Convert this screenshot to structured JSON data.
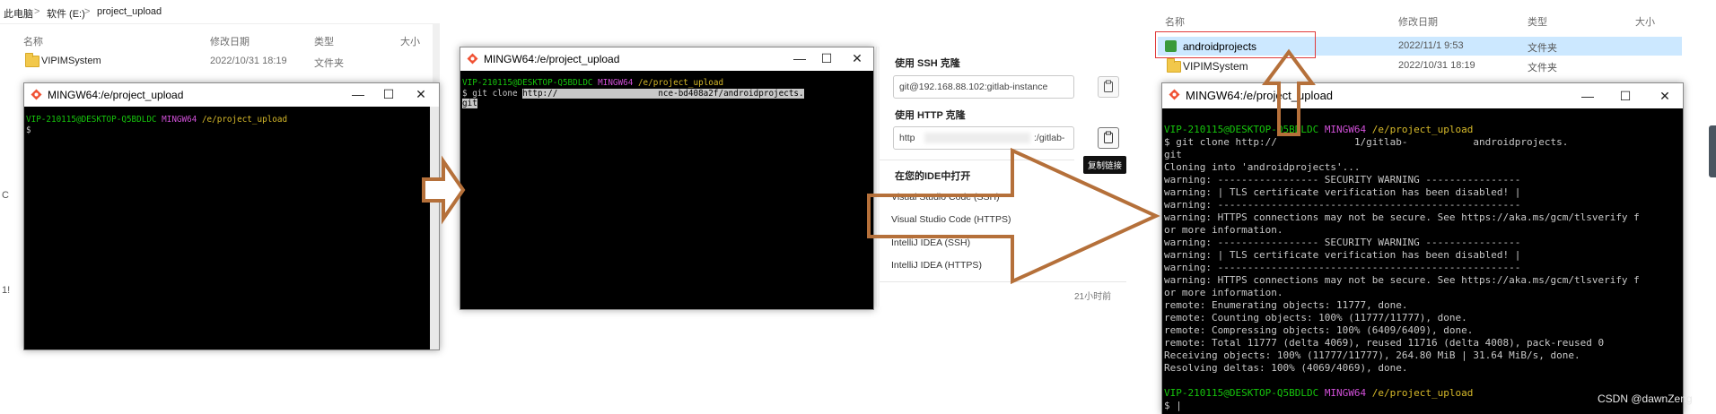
{
  "explorer_left": {
    "breadcrumb": [
      "此电脑",
      ">",
      "软件 (E:)",
      ">",
      "project_upload"
    ],
    "columns": [
      "名称",
      "修改日期",
      "类型",
      "大小"
    ],
    "rows": [
      {
        "name": "VIPIMSystem",
        "date": "2022/10/31 18:19",
        "type": "文件夹"
      }
    ],
    "side_labels": [
      "C",
      "1!"
    ]
  },
  "terminal_small": {
    "title": "MINGW64:/e/project_upload",
    "prompt_user": "VIP-210115@DESKTOP-Q5BDLDC",
    "prompt_env": "MINGW64",
    "prompt_path": "/e/project_upload",
    "cursor_line": "$"
  },
  "terminal_mid": {
    "title": "MINGW64:/e/project_upload",
    "prompt_user": "VIP-210115@DESKTOP-Q5BDLDC",
    "prompt_env": "MINGW64",
    "prompt_path": "/e/project_upload",
    "cmd_prefix": "$ git clone ",
    "cmd_url_start": "http://",
    "cmd_url_end": "nce-bd408a2f/androidprojects.",
    "cmd_url_wrap": "git"
  },
  "clone_panel": {
    "ssh_label": "使用 SSH 克隆",
    "ssh_value": "git@192.168.88.102:gitlab-instance",
    "http_label": "使用 HTTP 克隆",
    "http_value_start": "http",
    "http_value_end": ":/gitlab-",
    "tooltip": "复制链接",
    "ide_heading": "在您的IDE中打开",
    "ide_items": [
      "Visual Studio Code (SSH)",
      "Visual Studio Code (HTTPS)",
      "IntelliJ IDEA (SSH)",
      "IntelliJ IDEA (HTTPS)"
    ],
    "footer_time": "21小时前"
  },
  "explorer_right": {
    "columns": [
      "名称",
      "修改日期",
      "类型",
      "大小"
    ],
    "rows": [
      {
        "name": "androidprojects",
        "date": "2022/11/1 9:53",
        "type": "文件夹"
      },
      {
        "name": "VIPIMSystem",
        "date": "2022/10/31 18:19",
        "type": "文件夹"
      }
    ]
  },
  "terminal_big": {
    "title": "MINGW64:/e/project_upload",
    "prompt_user": "VIP-210115@DESKTOP-Q5BDLDC",
    "prompt_env": "MINGW64",
    "prompt_path": "/e/project_upload",
    "cmd_prefix": "$ git clone http://",
    "cmd_mid": "1/gitlab-",
    "cmd_end": "androidprojects.",
    "lines": [
      "git",
      "Cloning into 'androidprojects'...",
      "warning: ----------------- SECURITY WARNING ----------------",
      "warning: | TLS certificate verification has been disabled! |",
      "warning: ---------------------------------------------------",
      "warning: HTTPS connections may not be secure. See https://aka.ms/gcm/tlsverify f",
      "or more information.",
      "warning: ----------------- SECURITY WARNING ----------------",
      "warning: | TLS certificate verification has been disabled! |",
      "warning: ---------------------------------------------------",
      "warning: HTTPS connections may not be secure. See https://aka.ms/gcm/tlsverify f",
      "or more information.",
      "remote: Enumerating objects: 11777, done.",
      "remote: Counting objects: 100% (11777/11777), done.",
      "remote: Compressing objects: 100% (6409/6409), done.",
      "remote: Total 11777 (delta 4069), reused 11716 (delta 4008), pack-reused 0",
      "Receiving objects: 100% (11777/11777), 264.80 MiB | 31.64 MiB/s, done.",
      "Resolving deltas: 100% (4069/4069), done."
    ],
    "cursor_line": "$ |"
  },
  "watermark": "CSDN @dawnZeng",
  "window_controls": {
    "minimize": "—",
    "maximize": "☐",
    "close": "✕"
  },
  "colors": {
    "arrow": "#b5703a",
    "highlight_border": "#e03a3a",
    "selection": "#cce8ff",
    "prompt_green": "#16c60c",
    "prompt_magenta": "#d150d8",
    "prompt_yellow": "#d7ba2a"
  }
}
